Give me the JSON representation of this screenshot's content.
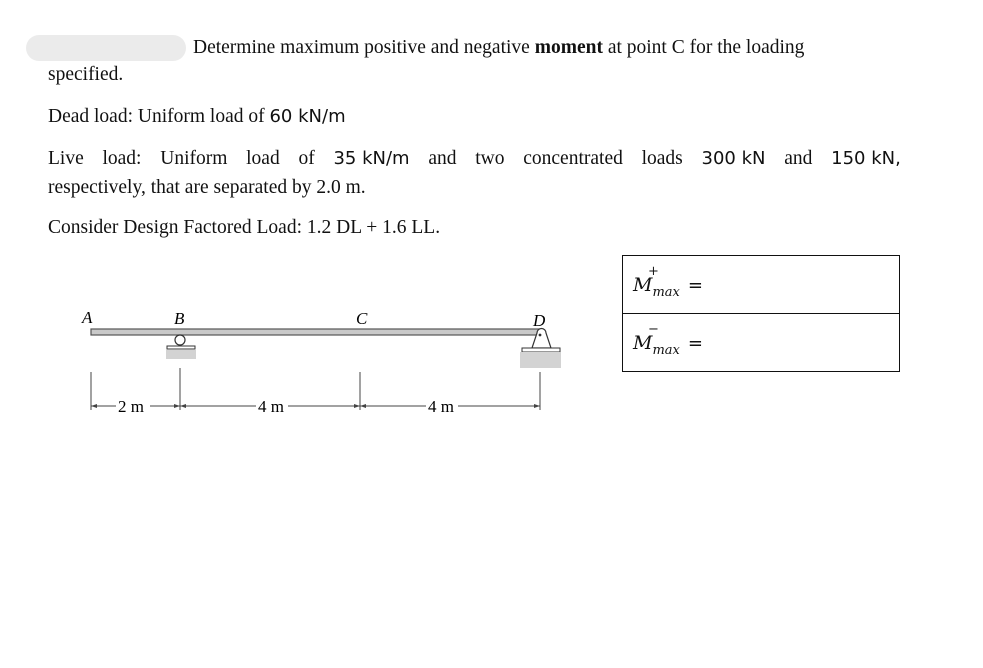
{
  "problem": {
    "intro": "Determine maximum positive and negative",
    "intro_bold": "moment",
    "intro_rest": "at point C for the loading",
    "intro_cont": "specified.",
    "dead_load_label": "Dead load: Uniform load of",
    "dead_load_value": "60 kN/m",
    "live_load_words": [
      "Live",
      "load:",
      "Uniform",
      "load",
      "of",
      "35 kN/m",
      "and",
      "two",
      "concentrated",
      "loads",
      "300 kN",
      "and",
      "150 kN,"
    ],
    "live_load_cont": "respectively, that are separated by 2.0 m.",
    "factored": "Consider Design Factored Load: 1.2 DL + 1.6 LL."
  },
  "diagram": {
    "points": [
      "A",
      "B",
      "C",
      "D"
    ],
    "spans": [
      {
        "from": "A",
        "to": "B",
        "label": "2 m",
        "length": 2
      },
      {
        "from": "B",
        "to": "C",
        "label": "4 m",
        "length": 4
      },
      {
        "from": "C",
        "to": "D",
        "label": "4 m",
        "length": 4
      }
    ],
    "supports": {
      "B": "roller",
      "D": "pin"
    }
  },
  "answers": [
    {
      "symbol": "M",
      "sup": "+",
      "sub": "max",
      "eq": "=",
      "value": ""
    },
    {
      "symbol": "M",
      "sup": "−",
      "sub": "max",
      "eq": "=",
      "value": ""
    }
  ]
}
